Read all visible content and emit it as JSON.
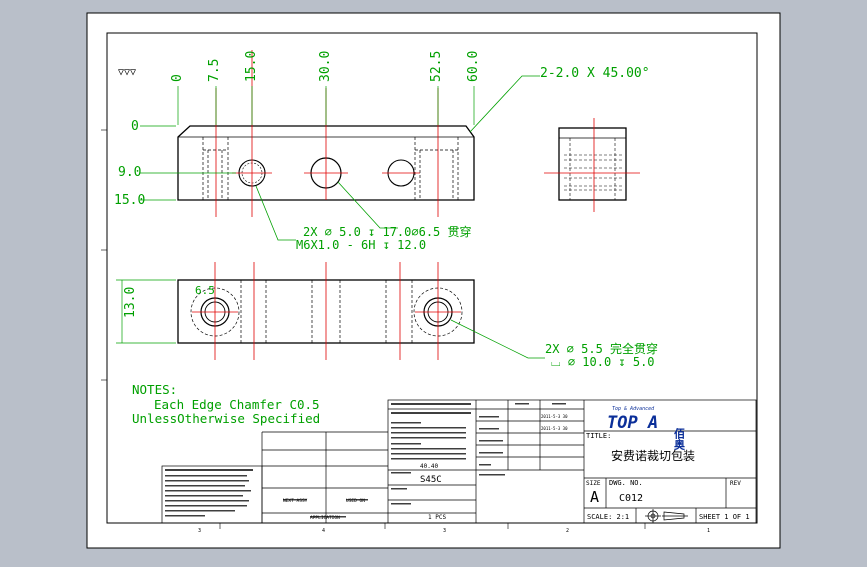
{
  "finish_symbol": "▽▽▽",
  "dims_top": [
    "0",
    "7.5",
    "15.0",
    "30.0",
    "52.5",
    "60.0"
  ],
  "dims_left": [
    "0",
    "9.0",
    "15.0"
  ],
  "dims_left_bottom": [
    "13.0"
  ],
  "chamfer_note": "2-2.0 X 45.00°",
  "hole_note_1": "2X ⌀ 5.0 ↧ 17.0⌀6.5 贯穿",
  "hole_note_2": "M6X1.0 - 6H ↧ 12.0",
  "hole_note_3": "2X ⌀ 5.5 完全贯穿",
  "hole_note_4": "⌴ ⌀ 10.0 ↧ 5.0",
  "bottom_small_dim": "6.5",
  "notes": {
    "title": "NOTES:",
    "line1": "Each Edge Chamfer C0.5",
    "line2": "UnlessOtherwise Specified"
  },
  "title_block": {
    "title_label": "TITLE:",
    "title_value": "安费诺裁切包装",
    "size_label": "SIZE",
    "size_value": "A",
    "dwg_label": "DWG. NO.",
    "dwg_value": "C012",
    "rev_label": "REV",
    "scale_label": "SCALE: 2:1",
    "sheet_label": "SHEET 1 OF 1",
    "material_value": "S45C",
    "finish_value": "40.40",
    "quantity_value": "1 PCS",
    "logo_text": "TOP A",
    "logo_tagline": "Top & Advanced",
    "logo_cn": "佰奥",
    "next_assy": "NEXT ASSY",
    "used_on": "USED ON",
    "application": "APPLICATION",
    "date1": "2011-5-3 30",
    "date2": "2011-5-3 30"
  },
  "border_numbers": {
    "bottom": [
      "3",
      "4",
      "3",
      "2",
      "1"
    ],
    "left": [
      "A",
      "B",
      "C",
      "D",
      "E"
    ]
  },
  "colors": {
    "dimension": "#00a000",
    "centerline": "#ff0000",
    "outline": "#000000",
    "logo": "#0b2f99"
  }
}
